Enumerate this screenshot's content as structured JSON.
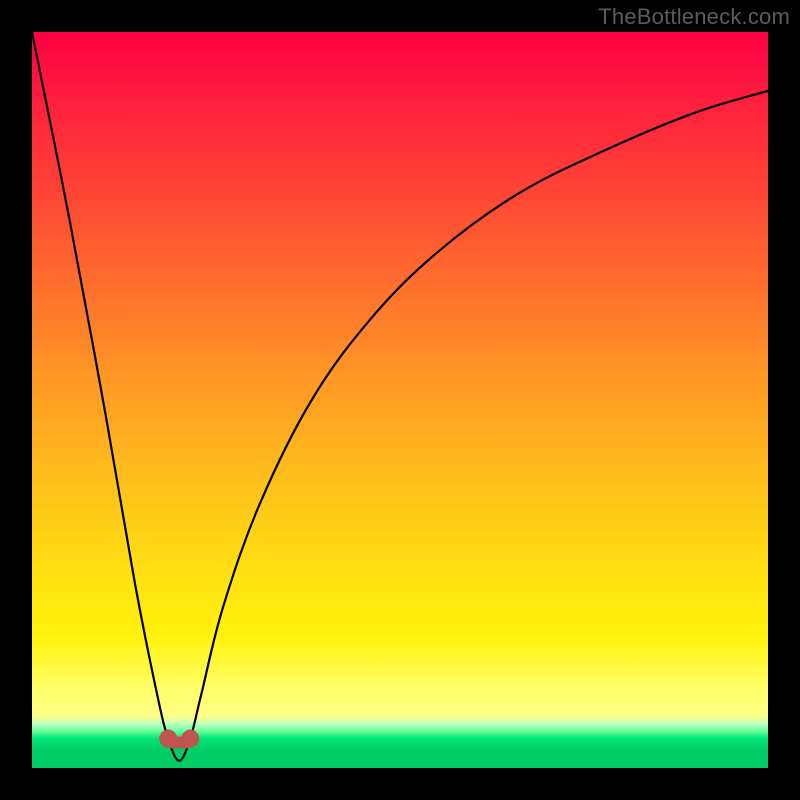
{
  "watermark": "TheBottleneck.com",
  "chart_data": {
    "type": "line",
    "title": "",
    "xlabel": "",
    "ylabel": "",
    "xlim": [
      0,
      100
    ],
    "ylim": [
      0,
      100
    ],
    "grid": false,
    "description": "Bottleneck curve over a red-to-green gradient. Optimum (zero bottleneck) at x≈20. Value rises steeply on either side, more gradually to the right.",
    "series": [
      {
        "name": "bottleneck-curve",
        "x": [
          0,
          5,
          10,
          14,
          17,
          18.5,
          20,
          21.5,
          23,
          26,
          31,
          38,
          46,
          55,
          66,
          78,
          90,
          100
        ],
        "values": [
          100,
          75,
          48,
          25,
          10,
          4,
          1,
          4,
          10,
          22,
          36,
          50,
          61,
          70,
          78,
          84,
          89,
          92
        ]
      }
    ],
    "markers": [
      {
        "x": 18.5,
        "y": 4
      },
      {
        "x": 21.5,
        "y": 4
      }
    ],
    "background_scale": {
      "orientation": "vertical",
      "meaning": "top = bad (red), bottom = good (green)"
    }
  }
}
